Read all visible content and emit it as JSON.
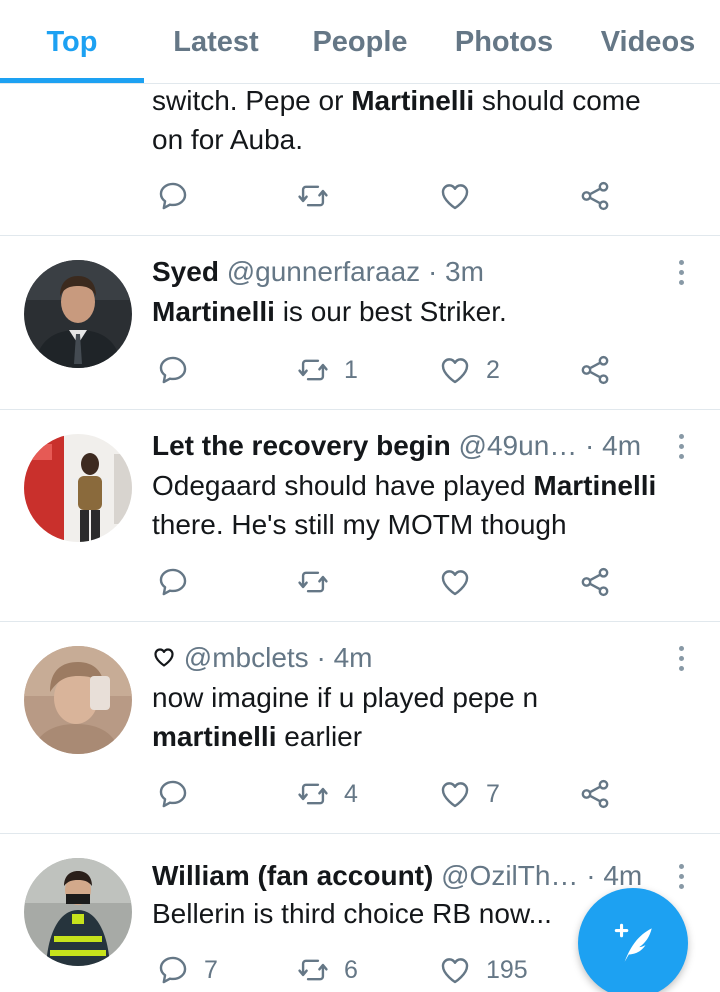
{
  "tabs": [
    {
      "label": "Top",
      "active": true
    },
    {
      "label": "Latest",
      "active": false
    },
    {
      "label": "People",
      "active": false
    },
    {
      "label": "Photos",
      "active": false
    },
    {
      "label": "Videos",
      "active": false
    }
  ],
  "colors": {
    "accent": "#1da1f2",
    "secondary_text": "#657786",
    "primary_text": "#14171a",
    "divider": "#e1e8ed"
  },
  "tweets": [
    {
      "body_line1_pre": "switch. Pepe or ",
      "body_line1_bold": "Martinelli",
      "body_line1_post": " should come",
      "body_line2": "on for Auba."
    },
    {
      "name": "Syed",
      "handle": "@gunnerfaraaz",
      "time": "· 3m",
      "body_bold": "Martinelli",
      "body_post": " is our best Striker.",
      "retweets": "1",
      "likes": "2"
    },
    {
      "name": "Let the recovery begin",
      "handle": "@49un…",
      "time": "· 4m",
      "body_line1_pre": "Odegaard should have played ",
      "body_line1_bold": "Martinelli",
      "body_line2": "there. He's still my MOTM though"
    },
    {
      "name_icon": "heart-outline-icon",
      "handle": "@mbclets",
      "time": "· 4m",
      "body_line1": "now imagine if u played pepe n",
      "body_line2_bold": "martinelli",
      "body_line2_post": " earlier",
      "retweets": "4",
      "likes": "7"
    },
    {
      "name": "William (fan account)",
      "handle": "@OzilTh…",
      "time": "· 4m",
      "body": "Bellerin is third choice RB now...",
      "replies": "7",
      "retweets": "6",
      "likes": "195"
    }
  ],
  "fab": {
    "icon": "compose-feather-icon"
  }
}
